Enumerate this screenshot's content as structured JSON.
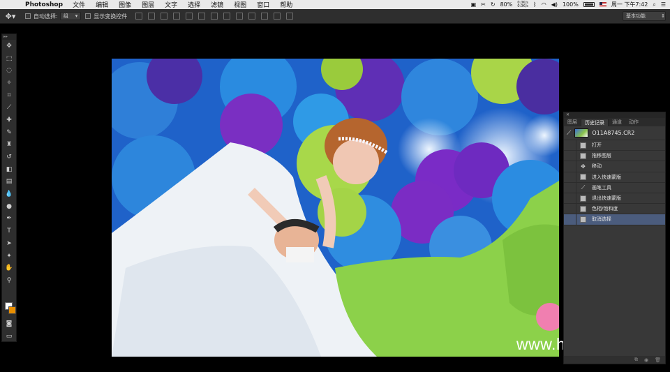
{
  "menubar": {
    "app_name": "Photoshop",
    "menus": [
      "文件",
      "编辑",
      "图像",
      "图层",
      "文字",
      "选择",
      "滤镜",
      "视图",
      "窗口",
      "帮助"
    ],
    "battery_percent_label": "80%",
    "net_up": "0.0K/s",
    "net_down": "0.0K/s",
    "battery2_label": "100%",
    "clock": "周一 下午7:42"
  },
  "options_bar": {
    "auto_select_label": "自动选择:",
    "auto_select_value": "组",
    "show_transform_label": "显示变换控件",
    "workspace_label": "基本功能"
  },
  "history_panel": {
    "tabs": [
      {
        "label": "图层",
        "active": false
      },
      {
        "label": "历史记录",
        "active": true
      },
      {
        "label": "通道",
        "active": false
      },
      {
        "label": "动作",
        "active": false
      }
    ],
    "snapshot_name": "O11A8745.CR2",
    "states": [
      {
        "label": "打开",
        "icon": "document-icon",
        "selected": false
      },
      {
        "label": "拖移图层",
        "icon": "document-icon",
        "selected": false
      },
      {
        "label": "移动",
        "icon": "move-icon",
        "selected": false
      },
      {
        "label": "进入快速蒙版",
        "icon": "document-icon",
        "selected": false
      },
      {
        "label": "画笔工具",
        "icon": "brush-icon",
        "selected": false
      },
      {
        "label": "退出快速蒙版",
        "icon": "document-icon",
        "selected": false
      },
      {
        "label": "色相/饱和度",
        "icon": "document-icon",
        "selected": false
      },
      {
        "label": "取消选择",
        "icon": "document-icon",
        "selected": true
      }
    ]
  },
  "watermark": "www.hunls.com",
  "colors": {
    "foreground": "#ffffff",
    "background": "#e88e00",
    "history_selected": "#4b5c7d"
  }
}
